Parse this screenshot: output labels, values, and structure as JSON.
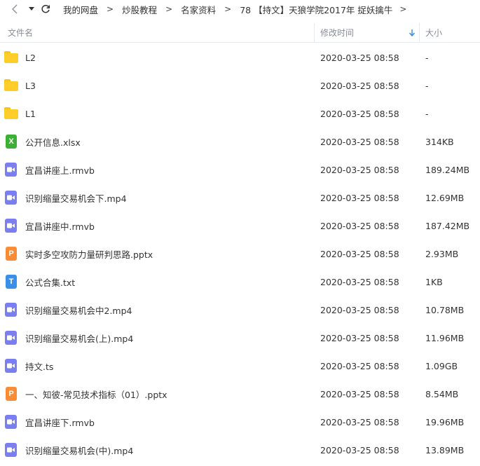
{
  "breadcrumb": [
    "我的网盘",
    "炒股教程",
    "名家资料",
    "78 【持文】天狼学院2017年 捉妖擒牛"
  ],
  "columns": {
    "name": "文件名",
    "modified": "修改时间",
    "size": "大小"
  },
  "files": [
    {
      "name": "L2",
      "time": "2020-03-25 08:58",
      "size": "-",
      "type": "folder"
    },
    {
      "name": "L3",
      "time": "2020-03-25 08:58",
      "size": "-",
      "type": "folder"
    },
    {
      "name": "L1",
      "time": "2020-03-25 08:58",
      "size": "-",
      "type": "folder"
    },
    {
      "name": "公开信息.xlsx",
      "time": "2020-03-25 08:58",
      "size": "314KB",
      "type": "xlsx"
    },
    {
      "name": "宜昌讲座上.rmvb",
      "time": "2020-03-25 08:58",
      "size": "189.24MB",
      "type": "video"
    },
    {
      "name": "识别缩量交易机会下.mp4",
      "time": "2020-03-25 08:58",
      "size": "12.69MB",
      "type": "video"
    },
    {
      "name": "宜昌讲座中.rmvb",
      "time": "2020-03-25 08:58",
      "size": "187.42MB",
      "type": "video"
    },
    {
      "name": "实时多空攻防力量研判思路.pptx",
      "time": "2020-03-25 08:58",
      "size": "2.93MB",
      "type": "pptx"
    },
    {
      "name": "公式合集.txt",
      "time": "2020-03-25 08:58",
      "size": "1KB",
      "type": "txt"
    },
    {
      "name": "识别缩量交易机会中2.mp4",
      "time": "2020-03-25 08:58",
      "size": "10.78MB",
      "type": "video"
    },
    {
      "name": "识别缩量交易机会(上).mp4",
      "time": "2020-03-25 08:58",
      "size": "11.96MB",
      "type": "video"
    },
    {
      "name": "持文.ts",
      "time": "2020-03-25 08:58",
      "size": "1.09GB",
      "type": "video"
    },
    {
      "name": "一、知彼-常见技术指标（01）.pptx",
      "time": "2020-03-25 08:58",
      "size": "8.54MB",
      "type": "pptx"
    },
    {
      "name": "宜昌讲座下.rmvb",
      "time": "2020-03-25 08:58",
      "size": "19.96MB",
      "type": "video"
    },
    {
      "name": "识别缩量交易机会(中).mp4",
      "time": "2020-03-25 08:58",
      "size": "13.89MB",
      "type": "video"
    }
  ],
  "icons": {
    "folder": "folder-icon",
    "xlsx": "excel-file-icon",
    "pptx": "powerpoint-file-icon",
    "txt": "text-file-icon",
    "video": "video-file-icon"
  },
  "colors": {
    "folder": "#ffcd29",
    "xlsx": "#3cb034",
    "pptx": "#fa8c35",
    "txt": "#3a8fe8",
    "video": "#7b7ef0",
    "sort_arrow": "#3a8fe8"
  },
  "icon_glyphs": {
    "xlsx": "X",
    "pptx": "P",
    "txt": "T"
  }
}
